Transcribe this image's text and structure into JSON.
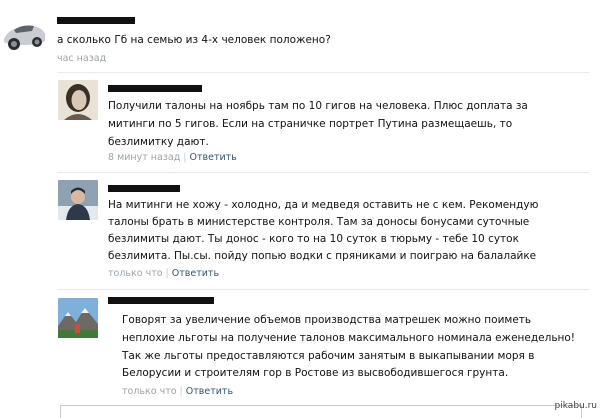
{
  "post": {
    "question": "а сколько Гб на семью из 4-х человек положено?",
    "time": "час назад"
  },
  "comments": [
    {
      "lines": [
        "Получили талоны на ноябрь там по 10 гигов на человека. Плюс доплата за",
        "митинги по 5 гигов. Если на страничке портрет Путина размещаешь, то",
        "безлимитку дают."
      ],
      "time": "8 минут назад",
      "reply": "Ответить"
    },
    {
      "lines": [
        "На митинги не хожу - холодно, да и медведя оставить не с кем. Рекомендую",
        "талоны брать в министерстве контроля. Там за доносы бонусами суточные",
        "безлимиты дают. Ты донос - кого то на 10 суток в тюрьму - тебе 10 суток",
        "безлимита. Пы.сы. пойду попью водки с пряниками и поиграю на балалайке"
      ],
      "time": "только что",
      "reply": "Ответить"
    },
    {
      "lines": [
        "Говорят за увеличение объемов производства матрешек можно поиметь",
        "неплохие льготы на получение талонов максимального номинала еженедельно!",
        "Так же льготы предоставляются рабочим занятым в выкапывании моря в",
        "Белорусии и строителям гор в Ростове из высвободившегося грунта."
      ],
      "time": "только что",
      "reply": "Ответить"
    }
  ],
  "watermark": "pikabu.ru"
}
